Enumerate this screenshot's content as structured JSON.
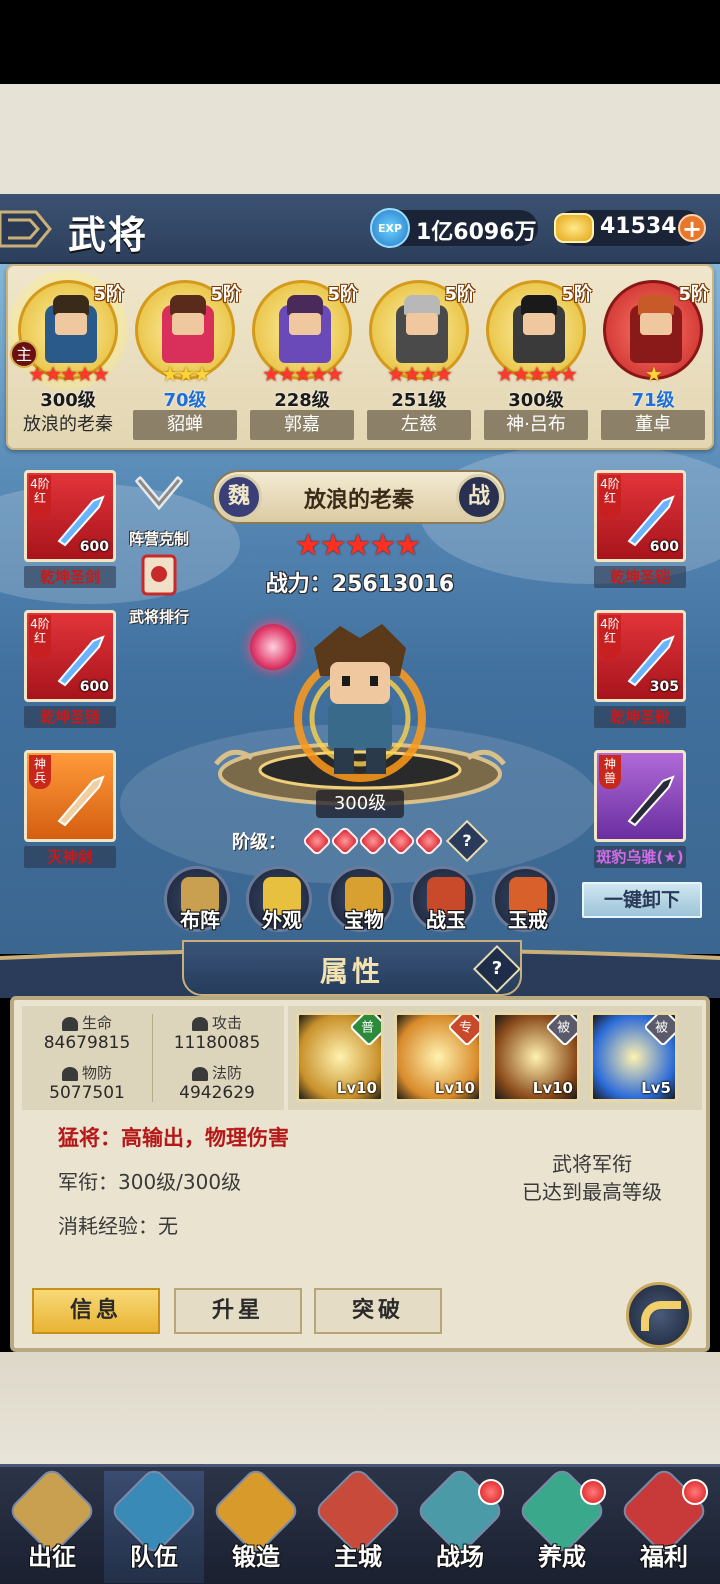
{
  "header": {
    "title": "武将",
    "exp_icon": "EXP",
    "exp_value": "1亿6096万",
    "gold_value": "41534",
    "gold_plus": "+"
  },
  "heroes": [
    {
      "stage": "5阶",
      "level": "300级",
      "name": "放浪的老秦",
      "stars": "★★★★★",
      "star_color": "red",
      "main_badge": "主",
      "selected": true,
      "face": "#3a2a1a",
      "body": "#2a5a8a"
    },
    {
      "stage": "5阶",
      "level": "70级",
      "name": "貂蝉",
      "stars": "★★★",
      "star_color": "gold",
      "face": "#5a2a1a",
      "body": "#d8305a"
    },
    {
      "stage": "5阶",
      "level": "228级",
      "name": "郭嘉",
      "stars": "★★★★★",
      "star_color": "red",
      "face": "#4a2a5a",
      "body": "#6a4ab8"
    },
    {
      "stage": "5阶",
      "level": "251级",
      "name": "左慈",
      "stars": "★★★★",
      "star_color": "red",
      "face": "#b8b8b8",
      "body": "#4a4a4a"
    },
    {
      "stage": "5阶",
      "level": "300级",
      "name": "神·吕布",
      "stars": "★★★★★",
      "star_color": "red",
      "face": "#1a1a1a",
      "body": "#3a3a3a"
    },
    {
      "stage": "5阶",
      "level": "71级",
      "name": "董卓",
      "stars": "★",
      "star_color": "gold",
      "face": "#c85a2a",
      "body": "#8a1a1a"
    }
  ],
  "equipment": {
    "left": [
      {
        "tag": "4阶红",
        "count": "600",
        "name": "乾坤圣剑"
      },
      {
        "tag": "4阶红",
        "count": "600",
        "name": "乾坤圣链"
      },
      {
        "tag": "神兵",
        "count": "",
        "name": "灭神剑"
      }
    ],
    "right": [
      {
        "tag": "4阶红",
        "count": "600",
        "name": "乾坤圣铠"
      },
      {
        "tag": "4阶红",
        "count": "305",
        "name": "乾坤圣靴"
      },
      {
        "tag": "神兽",
        "count": "",
        "name": "斑豹乌骓(★)"
      }
    ]
  },
  "side_buttons": {
    "camp": "阵营克制",
    "ranking": "武将排行"
  },
  "main_hero": {
    "faction": "魏",
    "name": "放浪的老秦",
    "battle_tag": "战",
    "stars": "★★★★★",
    "power": "战力：25613016",
    "level": "300级",
    "rank_label": "阶级：",
    "rank_gems": 5,
    "help": "?"
  },
  "function_buttons": [
    "布阵",
    "外观",
    "宝物",
    "战玉",
    "玉戒"
  ],
  "unequip_all": "一键卸下",
  "attributes": {
    "title": "属性",
    "help": "?",
    "stats": [
      {
        "key": "生命",
        "value": "84679815",
        "icon": "heart-icon"
      },
      {
        "key": "攻击",
        "value": "11180085",
        "icon": "swords-icon"
      },
      {
        "key": "物防",
        "value": "5077501",
        "icon": "paw-shield-icon"
      },
      {
        "key": "法防",
        "value": "4942629",
        "icon": "helmet-icon"
      }
    ],
    "skills": [
      {
        "type": "普",
        "level": "Lv10",
        "color": "#c8902a"
      },
      {
        "type": "专",
        "level": "Lv10",
        "color": "#d88a2a"
      },
      {
        "type": "被",
        "level": "Lv10",
        "color": "#8a4a1a"
      },
      {
        "type": "被",
        "level": "Lv5",
        "color": "#2a6ad8"
      }
    ],
    "type_desc": "猛将：高输出，物理伤害",
    "rank_desc": "军衔：300级/300级",
    "cost_desc": "消耗经验：无",
    "max_line1": "武将军衔",
    "max_line2": "已达到最高等级"
  },
  "tabs": [
    "信息",
    "升星",
    "突破"
  ],
  "nav": [
    {
      "label": "出征",
      "dot": false,
      "color": "#c8a050"
    },
    {
      "label": "队伍",
      "dot": false,
      "color": "#3a8ab8"
    },
    {
      "label": "锻造",
      "dot": false,
      "color": "#d89a2a"
    },
    {
      "label": "主城",
      "dot": false,
      "color": "#c84a3a"
    },
    {
      "label": "战场",
      "dot": true,
      "color": "#4a9aa8"
    },
    {
      "label": "养成",
      "dot": true,
      "color": "#3aa88a"
    },
    {
      "label": "福利",
      "dot": true,
      "color": "#c83a3a"
    }
  ]
}
